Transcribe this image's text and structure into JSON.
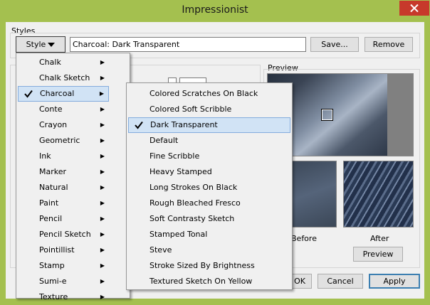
{
  "window": {
    "title": "Impressionist"
  },
  "styles_group": {
    "label": "Styles",
    "style_button": "Style",
    "current_style": "Charcoal: Dark Transparent",
    "save_button": "Save...",
    "remove_button": "Remove"
  },
  "preview_group": {
    "label": "Preview",
    "before_label": "Before",
    "after_label": "After",
    "preview_button": "Preview"
  },
  "footer": {
    "ok_button": "OK",
    "cancel_button": "Cancel",
    "apply_button": "Apply"
  },
  "style_menu": {
    "items": [
      {
        "label": "Chalk"
      },
      {
        "label": "Chalk Sketch"
      },
      {
        "label": "Charcoal"
      },
      {
        "label": "Conte"
      },
      {
        "label": "Crayon"
      },
      {
        "label": "Geometric"
      },
      {
        "label": "Ink"
      },
      {
        "label": "Marker"
      },
      {
        "label": "Natural"
      },
      {
        "label": "Paint"
      },
      {
        "label": "Pencil"
      },
      {
        "label": "Pencil Sketch"
      },
      {
        "label": "Pointillist"
      },
      {
        "label": "Stamp"
      },
      {
        "label": "Sumi-e"
      },
      {
        "label": "Texture"
      }
    ],
    "checked": "Charcoal"
  },
  "charcoal_submenu": {
    "items": [
      {
        "label": "Colored Scratches On Black"
      },
      {
        "label": "Colored Soft Scribble"
      },
      {
        "label": "Dark Transparent"
      },
      {
        "label": "Default"
      },
      {
        "label": "Fine Scribble"
      },
      {
        "label": "Heavy Stamped"
      },
      {
        "label": "Long Strokes On Black"
      },
      {
        "label": "Rough Bleached Fresco"
      },
      {
        "label": "Soft Contrasty Sketch"
      },
      {
        "label": "Stamped Tonal"
      },
      {
        "label": "Steve"
      },
      {
        "label": "Stroke Sized By Brightness"
      },
      {
        "label": "Textured Sketch On Yellow"
      }
    ],
    "checked": "Dark Transparent"
  },
  "icons": {
    "check": "checkmark-icon",
    "submenu": "submenu-arrow-icon",
    "close": "close-icon",
    "dropdown": "dropdown-arrow-icon"
  },
  "colors": {
    "title_bar": "#a4c04f",
    "close_button": "#c7392b",
    "menu_highlight": "#d1e3f5"
  }
}
